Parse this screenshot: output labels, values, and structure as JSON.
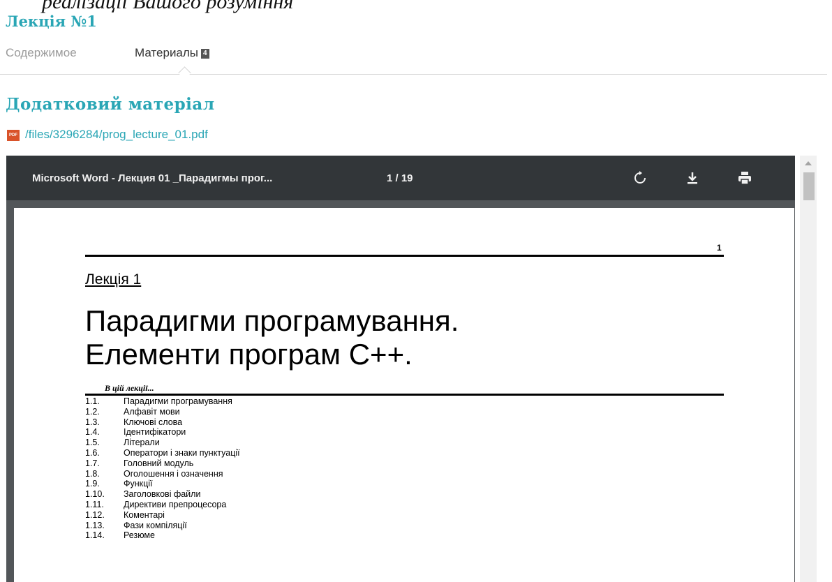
{
  "top_cut_text": "реалізації Вашого розуміння",
  "lecture_title": "Лекція №1",
  "tabs": [
    {
      "label": "Содержимое"
    },
    {
      "label": "Материалы",
      "badge": "4"
    }
  ],
  "section_title": "Додатковий матеріал",
  "file": {
    "icon": "pdf-file-icon",
    "link": "/files/3296284/prog_lecture_01.pdf"
  },
  "viewer": {
    "doc_title": "Microsoft Word - Лекция 01 _Парадигмы прог...",
    "page_indicator": "1 / 19",
    "icons": [
      "rotate-icon",
      "download-icon",
      "print-icon"
    ]
  },
  "page": {
    "page_number": "1",
    "lecture_label": "Лекція 1",
    "title_line1": "Парадигми програмування.",
    "title_line2": "Елементи програм С++.",
    "in_this_lecture": "В цій лекції...",
    "toc": [
      {
        "num": "1.1.",
        "text": "Парадигми програмування"
      },
      {
        "num": "1.2.",
        "text": "Алфавіт мови"
      },
      {
        "num": "1.3.",
        "text": "Ключові слова"
      },
      {
        "num": "1.4.",
        "text": "Ідентифікатори"
      },
      {
        "num": "1.5.",
        "text": "Літерали"
      },
      {
        "num": "1.6.",
        "text": "Оператори і знаки пунктуації"
      },
      {
        "num": "1.7.",
        "text": "Головний модуль"
      },
      {
        "num": "1.8.",
        "text": "Оголошення і означення"
      },
      {
        "num": "1.9.",
        "text": "Функції"
      },
      {
        "num": "1.10.",
        "text": "Заголовкові файли"
      },
      {
        "num": "1.11.",
        "text": "Директиви препроцесора"
      },
      {
        "num": "1.12.",
        "text": "Коментарі"
      },
      {
        "num": "1.13.",
        "text": "Фази компіляції"
      },
      {
        "num": "1.14.",
        "text": "Резюме"
      }
    ]
  },
  "colors": {
    "accent": "#2aa6b5",
    "toolbar": "#323639",
    "viewer_bg": "#525659"
  }
}
